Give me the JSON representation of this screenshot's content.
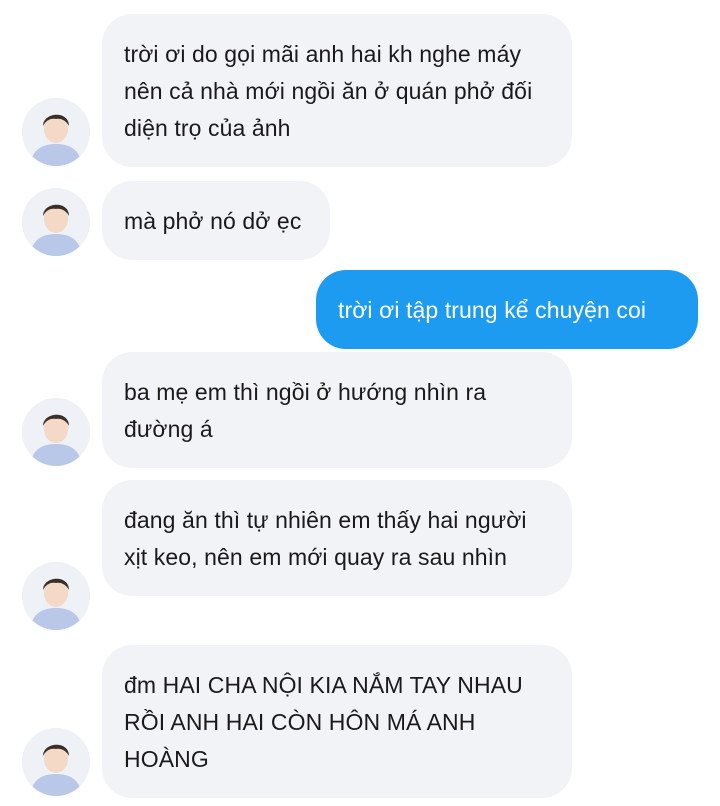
{
  "messages": [
    {
      "direction": "incoming",
      "text": "trời ơi do gọi mãi anh hai kh nghe máy nên cả nhà mới ngồi ăn ở quán phở đối diện trọ của ảnh",
      "avatar": "user-avatar"
    },
    {
      "direction": "incoming",
      "text": "mà phở nó dở ẹc",
      "avatar": "user-avatar"
    },
    {
      "direction": "outgoing",
      "text": "trời ơi tập trung kể chuyện coi"
    },
    {
      "direction": "incoming",
      "text": "ba mẹ em thì ngồi ở hướng nhìn ra đường á",
      "avatar": "user-avatar"
    },
    {
      "direction": "incoming",
      "text": "đang ăn thì tự nhiên em thấy hai người xịt keo, nên em mới quay ra sau nhìn",
      "avatar": "user-avatar"
    },
    {
      "direction": "incoming",
      "text": "đm HAI CHA NỘI KIA NẮM TAY NHAU RỒI ANH HAI CÒN HÔN MÁ ANH HOÀNG",
      "avatar": "user-avatar"
    }
  ],
  "colors": {
    "incoming_bubble": "#f1f3f7",
    "outgoing_bubble": "#1c9bf0",
    "incoming_text": "#1a1a1a",
    "outgoing_text": "#ffffff"
  }
}
